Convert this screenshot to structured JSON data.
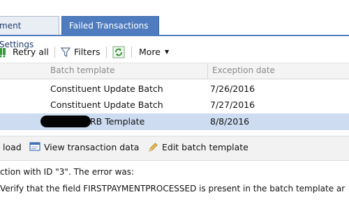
{
  "tabs": [
    {
      "label": "ment Settings",
      "active": false
    },
    {
      "label": "Failed Transactions",
      "active": true
    }
  ],
  "toolbar": {
    "retry_all": "Retry all",
    "filters": "Filters",
    "more": "More"
  },
  "grid": {
    "columns": [
      "Batch template",
      "Exception date"
    ],
    "rows": [
      {
        "template": "Constituent Update Batch",
        "date": "7/26/2016",
        "selected": false
      },
      {
        "template": "Constituent Update Batch",
        "date": "7/27/2016",
        "selected": false
      },
      {
        "template": "RB Template",
        "date": "8/8/2016",
        "selected": true
      }
    ]
  },
  "actions": {
    "download": "load",
    "view_transaction": "View transaction data",
    "edit_template": "Edit batch template"
  },
  "message": {
    "line1": "ction with ID \"3\". The error was:",
    "line2": " Verify that the field FIRSTPAYMENTPROCESSED is present in the batch template ar"
  },
  "colors": {
    "tab_active": "#4e7cbf",
    "selected_row": "#cddcf0"
  }
}
